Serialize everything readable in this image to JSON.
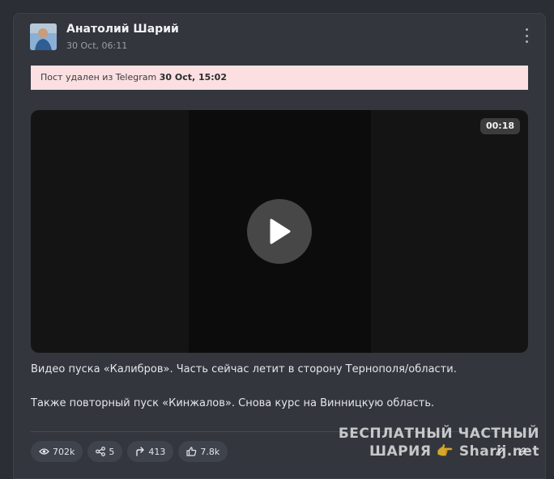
{
  "post": {
    "author": "Анатолий Шарий",
    "date": "30 Oct, 06:11",
    "deleted_notice_prefix": "Пост удален из Telegram",
    "deleted_notice_date": "30 Oct, 15:02",
    "video": {
      "duration": "00:18"
    },
    "text_lines": [
      "Видео пуска «Калибров». Часть сейчас летит в сторону Тернополя/области.",
      "Также повторный пуск «Кинжалов». Снова курс на Винницкую область."
    ],
    "stats": {
      "views": "702k",
      "shares": "5",
      "forwards": "413",
      "reactions": "7.8k"
    }
  },
  "watermark": {
    "line1": "БЕСПЛАТНЫЙ ЧАСТНЫЙ",
    "line2": "ШАРИЯ 👉 Sharij.net"
  },
  "colors": {
    "page_bg": "#2b2e34",
    "card_bg": "#33363d",
    "deleted_bg": "#fbdfe1",
    "stat_bg": "#3f434b"
  }
}
